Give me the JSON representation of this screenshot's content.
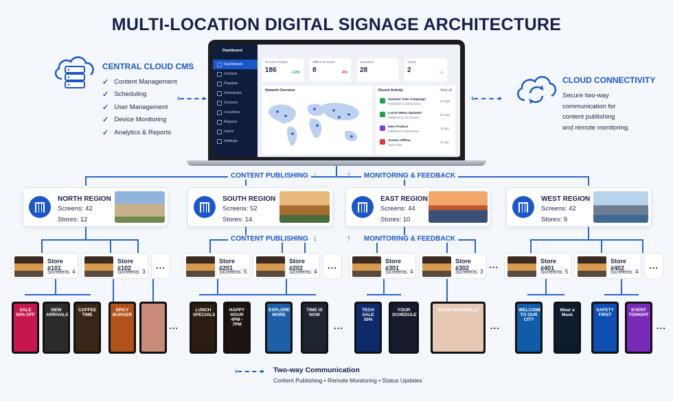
{
  "title": "MULTI-LOCATION DIGITAL SIGNAGE ARCHITECTURE",
  "cms": {
    "title": "CENTRAL CLOUD CMS",
    "icon": "cloud-server-icon",
    "features": [
      "Content Management",
      "Scheduling",
      "User Management",
      "Device Monitoring",
      "Analytics & Reports"
    ]
  },
  "connectivity": {
    "title": "CLOUD CONNECTIVITY",
    "icon": "cloud-sync-icon",
    "desc": [
      "Secure two-way",
      "communication for",
      "content publishing",
      "and remote monitoring."
    ]
  },
  "dashboard": {
    "brand": "Dashboard",
    "nav": [
      "Dashboard",
      "Content",
      "Playlists",
      "Schedules",
      "Screens",
      "Locations",
      "Reports",
      "Users",
      "Settings"
    ],
    "kpis": [
      {
        "label": "Screens Online",
        "value": "186",
        "delta": "+12%",
        "color": "#1aa34a"
      },
      {
        "label": "Offline Screens",
        "value": "8",
        "delta": "-8%",
        "color": "#e03b3b"
      },
      {
        "label": "Locations",
        "value": "28",
        "delta": "",
        "color": "#1aa34a"
      },
      {
        "label": "Alerts",
        "value": "2",
        "delta": "⚠",
        "color": "#f0a020"
      }
    ],
    "map_title": "Network Overview",
    "activity_title": "Recent Activity",
    "view_all": "View all",
    "activity": [
      {
        "title": "Summer Sale Campaign",
        "sub": "Published to 120 Screens",
        "ago": "2m ago",
        "color": "#1aa34a"
      },
      {
        "title": "Lunch Menu Updated",
        "sub": "Published to 45 Screens",
        "ago": "5m ago",
        "color": "#1aa34a"
      },
      {
        "title": "New Product",
        "sub": "Published to 38 Screens",
        "ago": "1h ago",
        "color": "#7b3fe0"
      },
      {
        "title": "Screen Offline",
        "sub": "Store #302",
        "ago": "2h ago",
        "color": "#e03b3b"
      }
    ]
  },
  "flows": {
    "publish": "CONTENT PUBLISHING",
    "monitor": "MONITORING & FEEDBACK"
  },
  "regions": [
    {
      "name": "NORTH REGION",
      "screens": "Screens: 42",
      "stores": "Stores:  12"
    },
    {
      "name": "SOUTH REGION",
      "screens": "Screens: 52",
      "stores": "Stores:  14"
    },
    {
      "name": "EAST REGION",
      "screens": "Screens: 44",
      "stores": "Stores:  10"
    },
    {
      "name": "WEST REGION",
      "screens": "Screens: 42",
      "stores": "Stores:  9"
    }
  ],
  "stores": [
    {
      "name": "Store #101",
      "screens": "Screens: 4"
    },
    {
      "name": "Store #102",
      "screens": "Screens: 3"
    },
    {
      "name": "Store #201",
      "screens": "Screens: 5"
    },
    {
      "name": "Store #202",
      "screens": "Screens: 4"
    },
    {
      "name": "Store #301",
      "screens": "Screens: 4"
    },
    {
      "name": "Store #302",
      "screens": "Screens: 3"
    },
    {
      "name": "Store #401",
      "screens": "Screens: 5"
    },
    {
      "name": "Store #402",
      "screens": "Screens: 4"
    }
  ],
  "more": "...",
  "signs": [
    {
      "text": "SALE 50% OFF",
      "bg": "#c8174f"
    },
    {
      "text": "NEW ARRIVALS",
      "bg": "#2b2b2b"
    },
    {
      "text": "COFFEE TIME",
      "bg": "#3a2616"
    },
    {
      "text": "SPICY BURGER",
      "bg": "#b0521a"
    },
    {
      "text": "",
      "bg": "#c98c7a"
    },
    {
      "text": "LUNCH SPECIALS",
      "bg": "#2c1d12"
    },
    {
      "text": "HAPPY HOUR 4PM - 7PM",
      "bg": "#1b1410"
    },
    {
      "text": "EXPLORE MORE",
      "bg": "#1d5fa8"
    },
    {
      "text": "TIME IS NOW",
      "bg": "#1e2430"
    },
    {
      "text": "TECH SALE 30%",
      "bg": "#0d2a6b"
    },
    {
      "text": "YOUR SCHEDULE",
      "bg": "#161b2e"
    },
    {
      "text": "GLOW NATURALLY",
      "bg": "#e6c8b4"
    },
    {
      "text": "WELCOME TO OUR CITY",
      "bg": "#0f5da8"
    },
    {
      "text": "Wear a Mask",
      "bg": "#0f1c30"
    },
    {
      "text": "SAFETY FIRST",
      "bg": "#0e4fb3"
    },
    {
      "text": "EVENT TONIGHT",
      "bg": "#7a2ab8"
    }
  ],
  "legend": {
    "title": "Two-way Communication",
    "items": "Content Publishing  •  Remote Monitoring  •  Status Updates"
  }
}
